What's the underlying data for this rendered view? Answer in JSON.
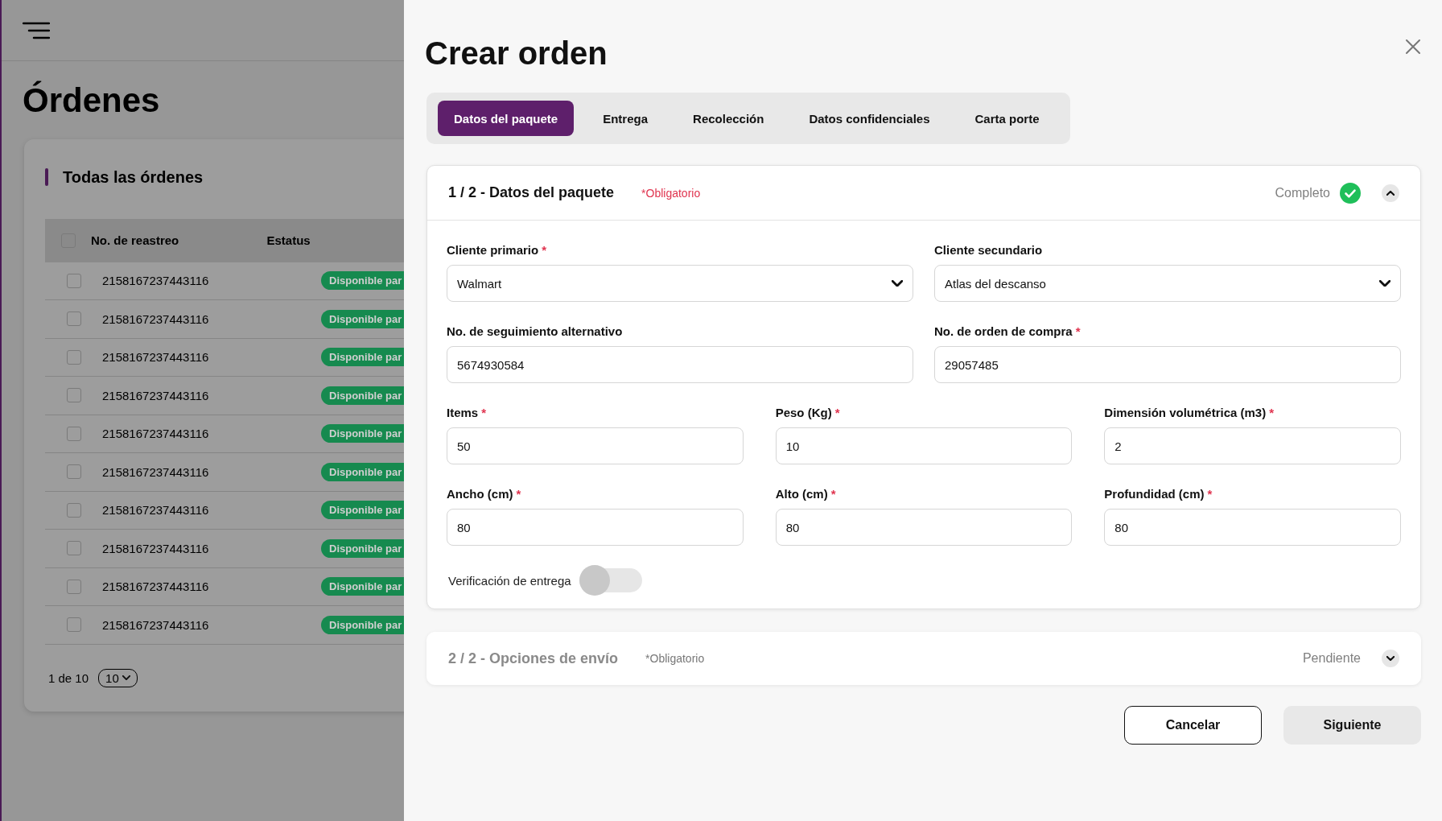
{
  "page": {
    "title": "Órdenes",
    "card_title": "Todas las órdenes",
    "table": {
      "header_checked": false,
      "columns": [
        "No. de reastreo",
        "Estatus"
      ],
      "rows": [
        {
          "checked": false,
          "tracking": "2158167237443116",
          "status": "Disponible par"
        },
        {
          "checked": false,
          "tracking": "2158167237443116",
          "status": "Disponible par"
        },
        {
          "checked": false,
          "tracking": "2158167237443116",
          "status": "Disponible par"
        },
        {
          "checked": false,
          "tracking": "2158167237443116",
          "status": "Disponible par"
        },
        {
          "checked": false,
          "tracking": "2158167237443116",
          "status": "Disponible par"
        },
        {
          "checked": false,
          "tracking": "2158167237443116",
          "status": "Disponible par"
        },
        {
          "checked": false,
          "tracking": "2158167237443116",
          "status": "Disponible par"
        },
        {
          "checked": false,
          "tracking": "2158167237443116",
          "status": "Disponible par"
        },
        {
          "checked": false,
          "tracking": "2158167237443116",
          "status": "Disponible par"
        },
        {
          "checked": false,
          "tracking": "2158167237443116",
          "status": "Disponible par"
        }
      ]
    },
    "pagination": {
      "page": "1 de 10",
      "page_size": "10"
    }
  },
  "drawer": {
    "title": "Crear orden",
    "tabs": [
      {
        "label": "Datos del paquete",
        "selected": true
      },
      {
        "label": "Entrega",
        "selected": false
      },
      {
        "label": "Recolección",
        "selected": false
      },
      {
        "label": "Datos confidenciales",
        "selected": false
      },
      {
        "label": "Carta porte",
        "selected": false
      }
    ],
    "sections": [
      {
        "heading": "1 / 2 - Datos del paquete",
        "required_note": "*Obligatorio",
        "status": "Completo",
        "complete": true,
        "expanded": true,
        "field_rows": [
          [
            {
              "kind": "select",
              "label": "Cliente primario",
              "required_mark": "*",
              "value": "Walmart"
            },
            {
              "kind": "select",
              "label": "Cliente secundario",
              "value": "Atlas del descanso"
            }
          ],
          [
            {
              "kind": "text",
              "label": "No. de seguimiento alternativo",
              "value": "5674930584"
            },
            {
              "kind": "text",
              "label": "No. de orden de compra",
              "required_mark": "*",
              "value": "29057485"
            }
          ],
          [
            {
              "kind": "text",
              "label": "Items",
              "required_mark": "*",
              "value": "50"
            },
            {
              "kind": "text",
              "label": "Peso  (Kg)",
              "required_mark": "*",
              "value": "10"
            },
            {
              "kind": "text",
              "label": "Dimensión volumétrica (m3)",
              "required_mark": "*",
              "value": "2"
            }
          ],
          [
            {
              "kind": "text",
              "label": "Ancho (cm)",
              "required_mark": "*",
              "value": "80"
            },
            {
              "kind": "text",
              "label": "Alto  (cm)",
              "required_mark": "*",
              "value": "80"
            },
            {
              "kind": "text",
              "label": "Profundidad (cm)",
              "required_mark": "*",
              "value": "80"
            }
          ]
        ],
        "toggle": {
          "label": "Verificación de entrega",
          "on": false
        }
      },
      {
        "heading": "2 / 2 - Opciones de envío",
        "required_note": "*Obligatorio",
        "status": "Pendiente",
        "complete": false,
        "expanded": false
      }
    ],
    "buttons": [
      {
        "kind": "secondary",
        "label": "Cancelar"
      },
      {
        "kind": "primary",
        "label": "Siguiente"
      }
    ]
  }
}
